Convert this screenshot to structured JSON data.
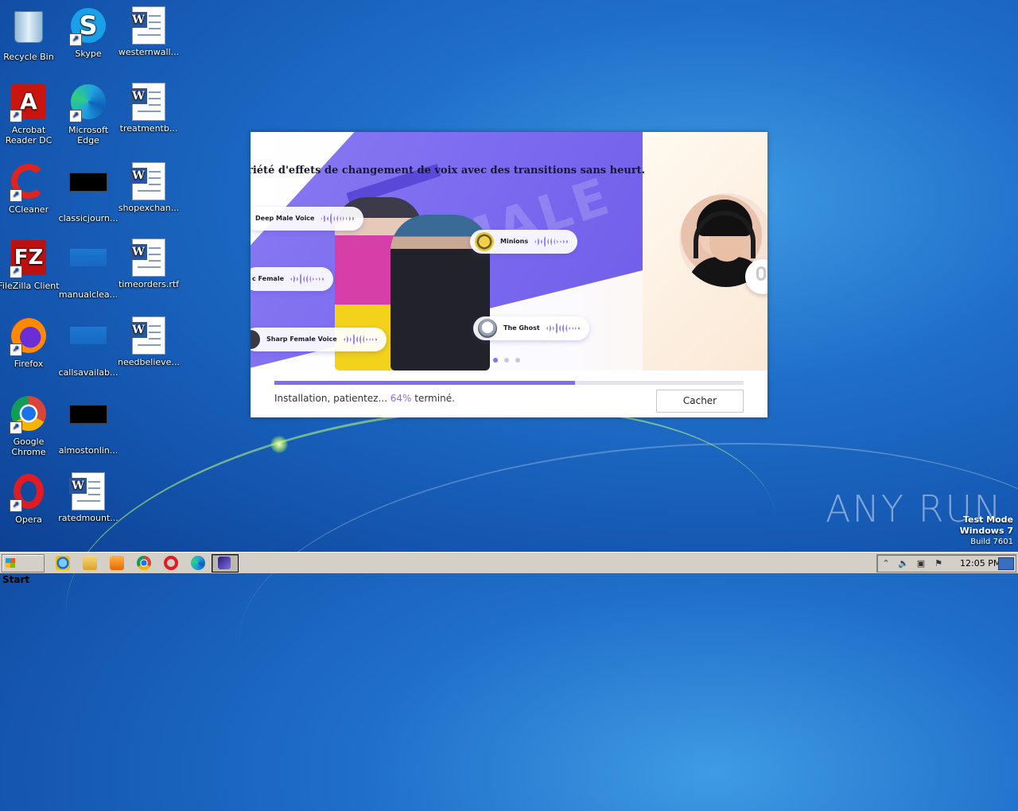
{
  "desktop": {
    "icons": [
      {
        "label": "Recycle Bin"
      },
      {
        "label": "Skype"
      },
      {
        "label": "westernwall..."
      },
      {
        "label": "Acrobat Reader DC"
      },
      {
        "label": "Microsoft Edge"
      },
      {
        "label": "treatmentb..."
      },
      {
        "label": "CCleaner"
      },
      {
        "label": "classicjourn..."
      },
      {
        "label": "shopexchan..."
      },
      {
        "label": "FileZilla Client"
      },
      {
        "label": "manualclea..."
      },
      {
        "label": "timeorders.rtf"
      },
      {
        "label": "Firefox"
      },
      {
        "label": "callsavailab..."
      },
      {
        "label": "needbelieve..."
      },
      {
        "label": "Google Chrome"
      },
      {
        "label": "almostonlin..."
      },
      {
        "label": "Opera"
      },
      {
        "label": "ratedmount..."
      }
    ]
  },
  "installer": {
    "banner_title": "riété d'effets de changement de voix avec des transitions sans heurt.",
    "watermark": "FEMALE",
    "chips": [
      {
        "label": "Deep Male Voice"
      },
      {
        "label": "Minions"
      },
      {
        "label": "c Female"
      },
      {
        "label": "Sharp Female Voice"
      },
      {
        "label": "The Ghost"
      }
    ],
    "progress": 0.64,
    "status_prefix": "Installation, patientez...",
    "status_percent": "64%",
    "status_suffix": "terminé.",
    "hide_button": "Cacher",
    "accent_color": "#7f6cf0"
  },
  "branding": {
    "anyrun": "ANY RUN",
    "test_mode": "Test Mode",
    "os": "Windows 7",
    "build": "Build 7601"
  },
  "taskbar": {
    "start_label": "Start",
    "clock": "12:05 PM",
    "quick_launch": [
      "ie-icon",
      "explorer-icon",
      "media-player-icon",
      "chrome-icon",
      "opera-icon",
      "edge-icon"
    ]
  }
}
